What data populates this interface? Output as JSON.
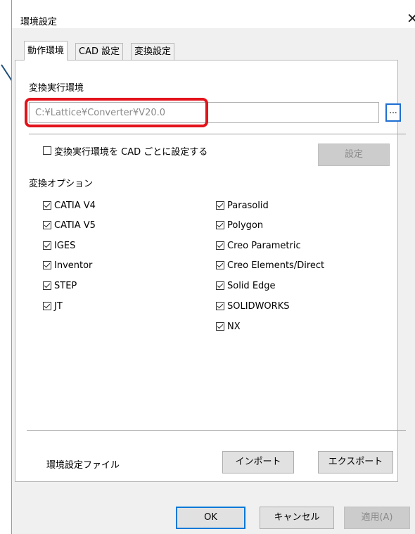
{
  "window": {
    "title": "環境設定",
    "close_glyph": "✕"
  },
  "tabs": [
    {
      "label": "動作環境",
      "active": true
    },
    {
      "label": "CAD 設定",
      "active": false
    },
    {
      "label": "変換設定",
      "active": false
    }
  ],
  "exec_env": {
    "heading": "変換実行環境",
    "path_value": "C:¥Lattice¥Converter¥V20.0",
    "browse_label": "...",
    "per_cad_label": "変換実行環境を CAD ごとに設定する",
    "per_cad_checked": false,
    "settings_button": "設定"
  },
  "options": {
    "heading": "変換オプション",
    "left": [
      {
        "label": "CATIA V4",
        "checked": true
      },
      {
        "label": "CATIA V5",
        "checked": true
      },
      {
        "label": "IGES",
        "checked": true
      },
      {
        "label": "Inventor",
        "checked": true
      },
      {
        "label": "STEP",
        "checked": true
      },
      {
        "label": "JT",
        "checked": true
      }
    ],
    "right": [
      {
        "label": "Parasolid",
        "checked": true
      },
      {
        "label": "Polygon",
        "checked": true
      },
      {
        "label": "Creo Parametric",
        "checked": true
      },
      {
        "label": "Creo Elements/Direct",
        "checked": true
      },
      {
        "label": "Solid Edge",
        "checked": true
      },
      {
        "label": "SOLIDWORKS",
        "checked": true
      },
      {
        "label": "NX",
        "checked": true
      }
    ]
  },
  "env_file": {
    "label": "環境設定ファイル",
    "import_button": "インポート",
    "export_button": "エクスポート"
  },
  "footer": {
    "ok": "OK",
    "cancel": "キャンセル",
    "apply": "適用(A)"
  },
  "colors": {
    "highlight": "#e3131b",
    "arrow": "#1f4e79",
    "browse_border": "#1e6fd1"
  }
}
